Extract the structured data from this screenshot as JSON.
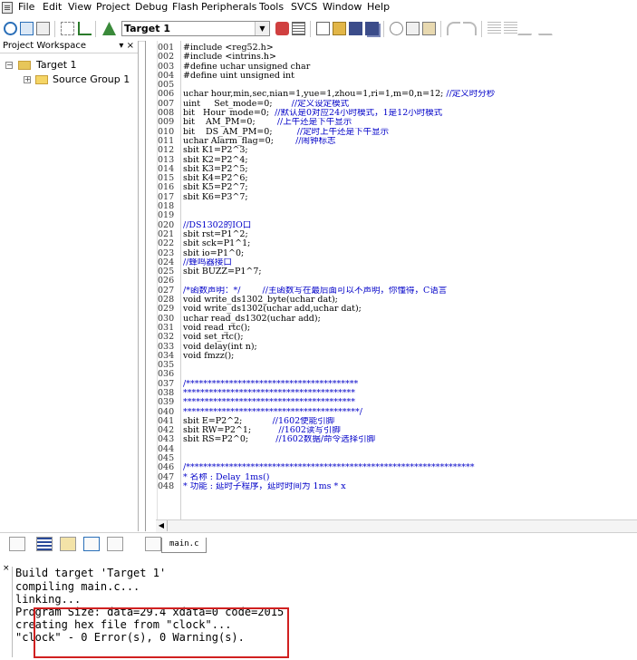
{
  "menu": [
    "File",
    "Edit",
    "View",
    "Project",
    "Debug",
    "Flash",
    "Peripherals",
    "Tools",
    "SVCS",
    "Window",
    "Help"
  ],
  "toolbar": {
    "target": "Target 1"
  },
  "project": {
    "header": "Project Workspace",
    "pin": "▾ ×",
    "target": "Target 1",
    "group": "Source Group 1"
  },
  "editor": {
    "line_numbers": [
      "001",
      "002",
      "003",
      "004",
      "005",
      "006",
      "007",
      "008",
      "009",
      "010",
      "011",
      "012",
      "013",
      "014",
      "015",
      "016",
      "017",
      "018",
      "019",
      "020",
      "021",
      "022",
      "023",
      "024",
      "025",
      "026",
      "027",
      "028",
      "029",
      "030",
      "031",
      "032",
      "033",
      "034",
      "035",
      "036",
      "037",
      "038",
      "039",
      "040",
      "041",
      "042",
      "043",
      "044",
      "045",
      "046",
      "047",
      "048"
    ],
    "lines": [
      {
        "code": "#include <reg52.h>",
        "comment": ""
      },
      {
        "code": "#include <intrins.h>",
        "comment": ""
      },
      {
        "code": "#define uchar unsigned char",
        "comment": ""
      },
      {
        "code": "#define uint unsigned int",
        "comment": ""
      },
      {
        "code": "",
        "comment": ""
      },
      {
        "code": "uchar hour,min,sec,nian=1,yue=1,zhou=1,ri=1,m=0,n=12; ",
        "comment": "//定义时分秒"
      },
      {
        "code": "uint     Set_mode=0;       ",
        "comment": "//定义设定模式"
      },
      {
        "code": "bit   Hour_mode=0;  ",
        "comment": "//默认是0对应24小时模式，1是12小时模式"
      },
      {
        "code": "bit    AM_PM=0;        ",
        "comment": "//上午还是下午显示"
      },
      {
        "code": "bit    DS_AM_PM=0;         ",
        "comment": "//定时上午还是下午显示"
      },
      {
        "code": "uchar Alarm_flag=0;        ",
        "comment": "//闹钟标志"
      },
      {
        "code": "sbit K1=P2^3;",
        "comment": ""
      },
      {
        "code": "sbit K2=P2^4;",
        "comment": ""
      },
      {
        "code": "sbit K3=P2^5;",
        "comment": ""
      },
      {
        "code": "sbit K4=P2^6;",
        "comment": ""
      },
      {
        "code": "sbit K5=P2^7;",
        "comment": ""
      },
      {
        "code": "sbit K6=P3^7;",
        "comment": ""
      },
      {
        "code": "",
        "comment": ""
      },
      {
        "code": "",
        "comment": ""
      },
      {
        "code": "",
        "comment": "//DS1302的IO口"
      },
      {
        "code": "sbit rst=P1^2;",
        "comment": ""
      },
      {
        "code": "sbit sck=P1^1;",
        "comment": ""
      },
      {
        "code": "sbit io=P1^0;",
        "comment": ""
      },
      {
        "code": "",
        "comment": "//蜂鸣器接口"
      },
      {
        "code": "sbit BUZZ=P1^7;",
        "comment": ""
      },
      {
        "code": "",
        "comment": ""
      },
      {
        "code": "",
        "comment": "/*函数声明：*/        //主函数写在最后面可以不声明，你懂得，C语言"
      },
      {
        "code": "void write_ds1302_byte(uchar dat);",
        "comment": ""
      },
      {
        "code": "void write_ds1302(uchar add,uchar dat);",
        "comment": ""
      },
      {
        "code": "uchar read_ds1302(uchar add);",
        "comment": ""
      },
      {
        "code": "void read_rtc();",
        "comment": ""
      },
      {
        "code": "void set_rtc();",
        "comment": ""
      },
      {
        "code": "void delay(int n);",
        "comment": ""
      },
      {
        "code": "void fmzz();",
        "comment": ""
      },
      {
        "code": "",
        "comment": ""
      },
      {
        "code": "",
        "comment": ""
      },
      {
        "code": "",
        "comment": "/****************************************"
      },
      {
        "code": "",
        "comment": "****************************************"
      },
      {
        "code": "",
        "comment": "****************************************"
      },
      {
        "code": "",
        "comment": "*****************************************/"
      },
      {
        "code": "sbit E=P2^2;           ",
        "comment": "//1602使能引脚"
      },
      {
        "code": "sbit RW=P2^1;          ",
        "comment": "//1602读写引脚"
      },
      {
        "code": "sbit RS=P2^0;          ",
        "comment": "//1602数据/命令选择引脚"
      },
      {
        "code": "",
        "comment": ""
      },
      {
        "code": "",
        "comment": ""
      },
      {
        "code": "",
        "comment": "/*******************************************************************"
      },
      {
        "code": "",
        "comment": "* 名称 : Delay_1ms()"
      },
      {
        "code": "",
        "comment": "* 功能 : 延时子程序，延时时间为 1ms * x"
      }
    ]
  },
  "file_tab": "main.c",
  "output": [
    "Build target 'Target 1'",
    "compiling main.c...",
    "linking...",
    "Program Size: data=29.4 xdata=0 code=2015",
    "creating hex file from \"clock\"...",
    "\"clock\" - 0 Error(s), 0 Warning(s)."
  ]
}
